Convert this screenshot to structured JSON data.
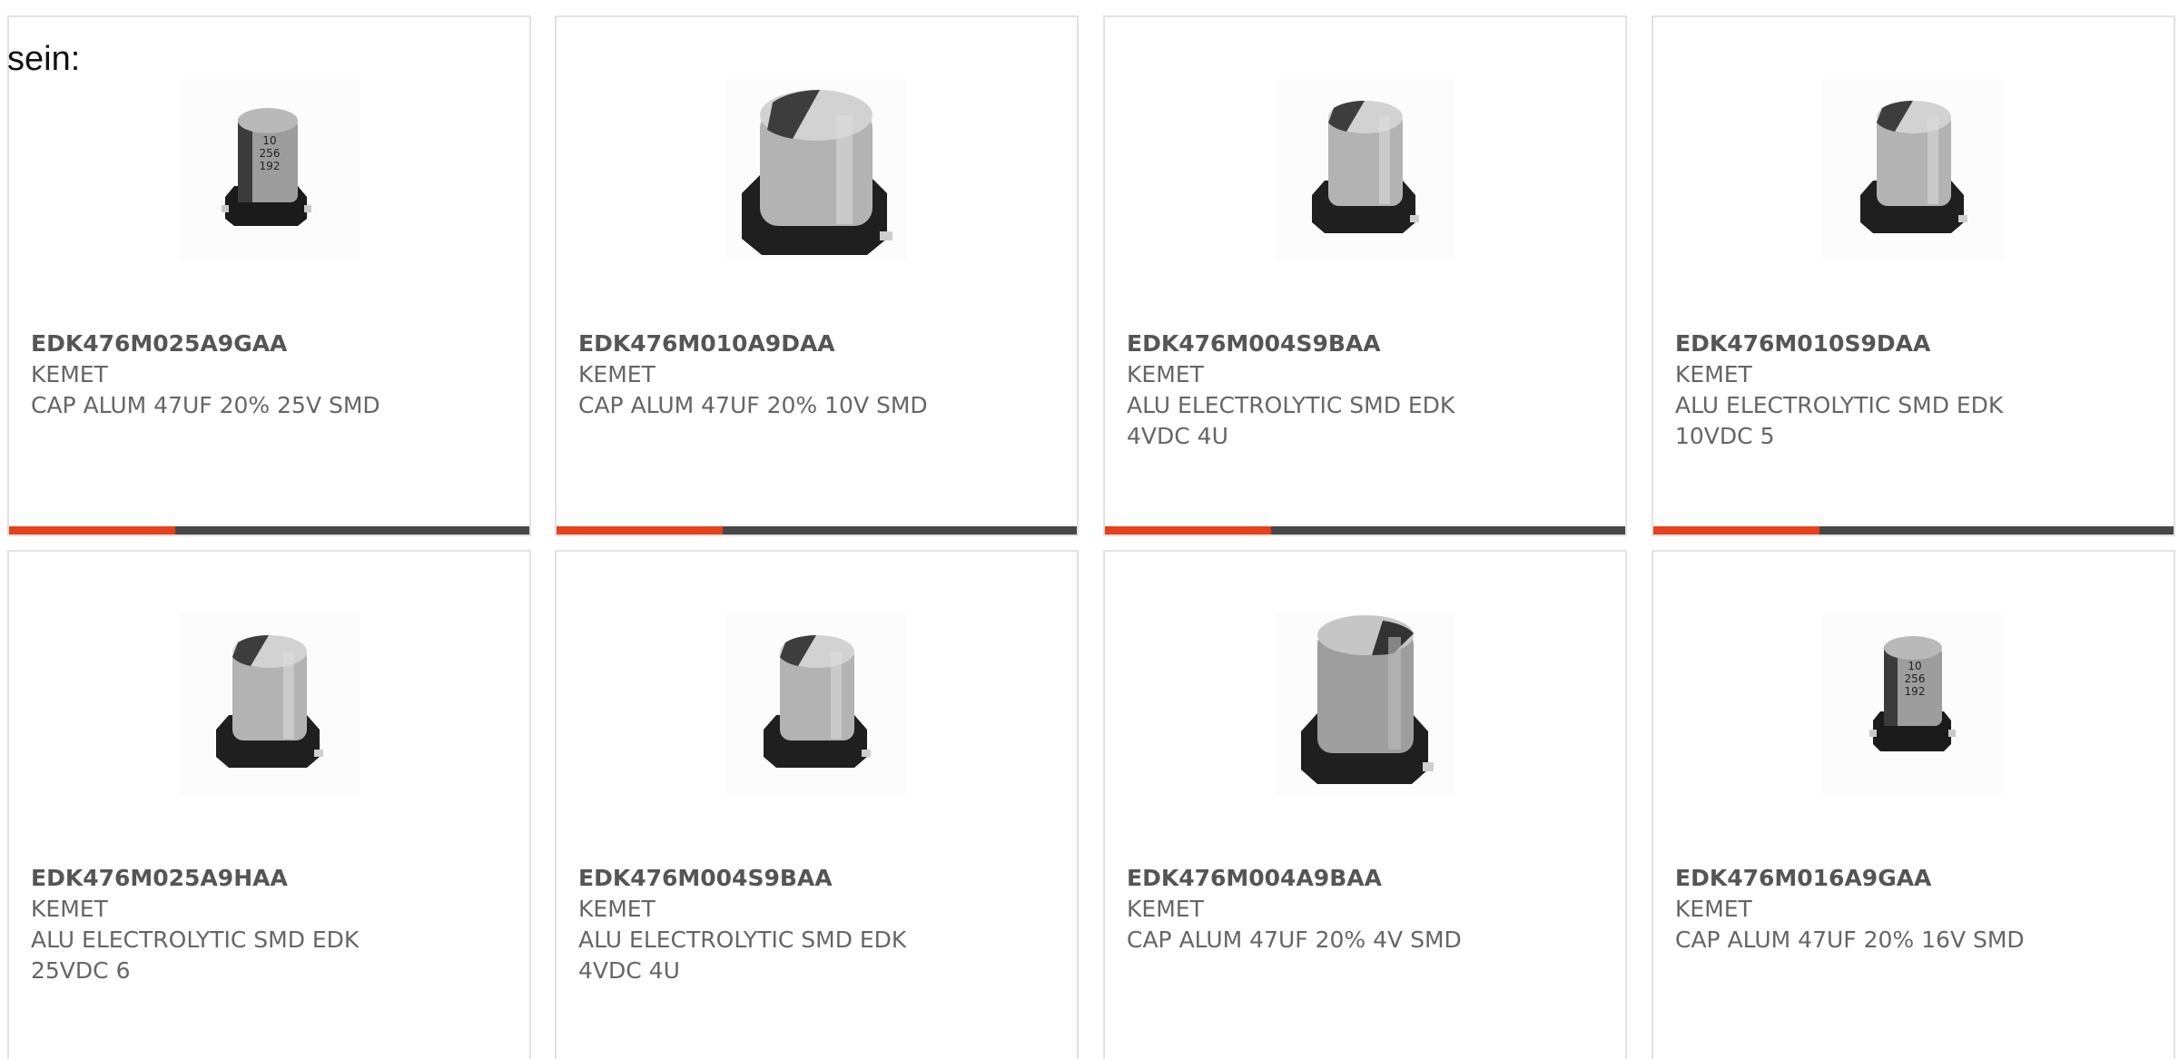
{
  "intro_text": "sein:",
  "accent_color": "#e8401c",
  "bar_color": "#474747",
  "products": [
    {
      "part_number": "EDK476M025A9GAA",
      "manufacturer": "KEMET",
      "description": "CAP ALUM 47UF 20% 25V SMD",
      "image_icon": "smd-electrolytic-capacitor-marked-icon",
      "marking": [
        "10",
        "256",
        "192"
      ]
    },
    {
      "part_number": "EDK476M010A9DAA",
      "manufacturer": "KEMET",
      "description": "CAP ALUM 47UF 20% 10V SMD",
      "image_icon": "smd-electrolytic-capacitor-icon"
    },
    {
      "part_number": "EDK476M004S9BAA",
      "manufacturer": "KEMET",
      "description": "ALU ELECTROLYTIC SMD EDK 4VDC 4U",
      "image_icon": "smd-electrolytic-capacitor-icon"
    },
    {
      "part_number": "EDK476M010S9DAA",
      "manufacturer": "KEMET",
      "description": "ALU ELECTROLYTIC SMD EDK 10VDC 5",
      "image_icon": "smd-electrolytic-capacitor-icon"
    },
    {
      "part_number": "EDK476M025A9HAA",
      "manufacturer": "KEMET",
      "description": "ALU ELECTROLYTIC SMD EDK 25VDC 6",
      "image_icon": "smd-electrolytic-capacitor-icon"
    },
    {
      "part_number": "EDK476M004S9BAA",
      "manufacturer": "KEMET",
      "description": "ALU ELECTROLYTIC SMD EDK 4VDC 4U",
      "image_icon": "smd-electrolytic-capacitor-icon"
    },
    {
      "part_number": "EDK476M004A9BAA",
      "manufacturer": "KEMET",
      "description": "CAP ALUM 47UF 20% 4V SMD",
      "image_icon": "smd-electrolytic-capacitor-icon"
    },
    {
      "part_number": "EDK476M016A9GAA",
      "manufacturer": "KEMET",
      "description": "CAP ALUM 47UF 20% 16V SMD",
      "image_icon": "smd-electrolytic-capacitor-marked-icon",
      "marking": [
        "10",
        "256",
        "192"
      ]
    }
  ]
}
